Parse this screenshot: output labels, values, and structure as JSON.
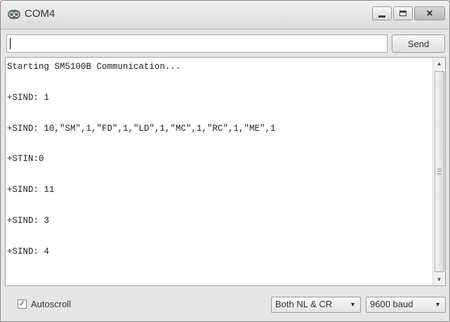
{
  "window": {
    "title": "COM4",
    "controls": {
      "minimize": "minimize",
      "maximize": "maximize",
      "close": "✕"
    }
  },
  "input": {
    "value": "",
    "placeholder": ""
  },
  "send_button": {
    "label": "Send"
  },
  "console": {
    "lines": [
      "Starting SM5100B Communication...",
      "+SIND: 1",
      "+SIND: 10,\"SM\",1,\"FD\",1,\"LD\",1,\"MC\",1,\"RC\",1,\"ME\",1",
      "+STIN:0",
      "+SIND: 11",
      "+SIND: 3",
      "+SIND: 4"
    ]
  },
  "footer": {
    "autoscroll_label": "Autoscroll",
    "autoscroll_checked": true,
    "line_ending": "Both NL & CR",
    "baud_rate": "9600 baud"
  }
}
